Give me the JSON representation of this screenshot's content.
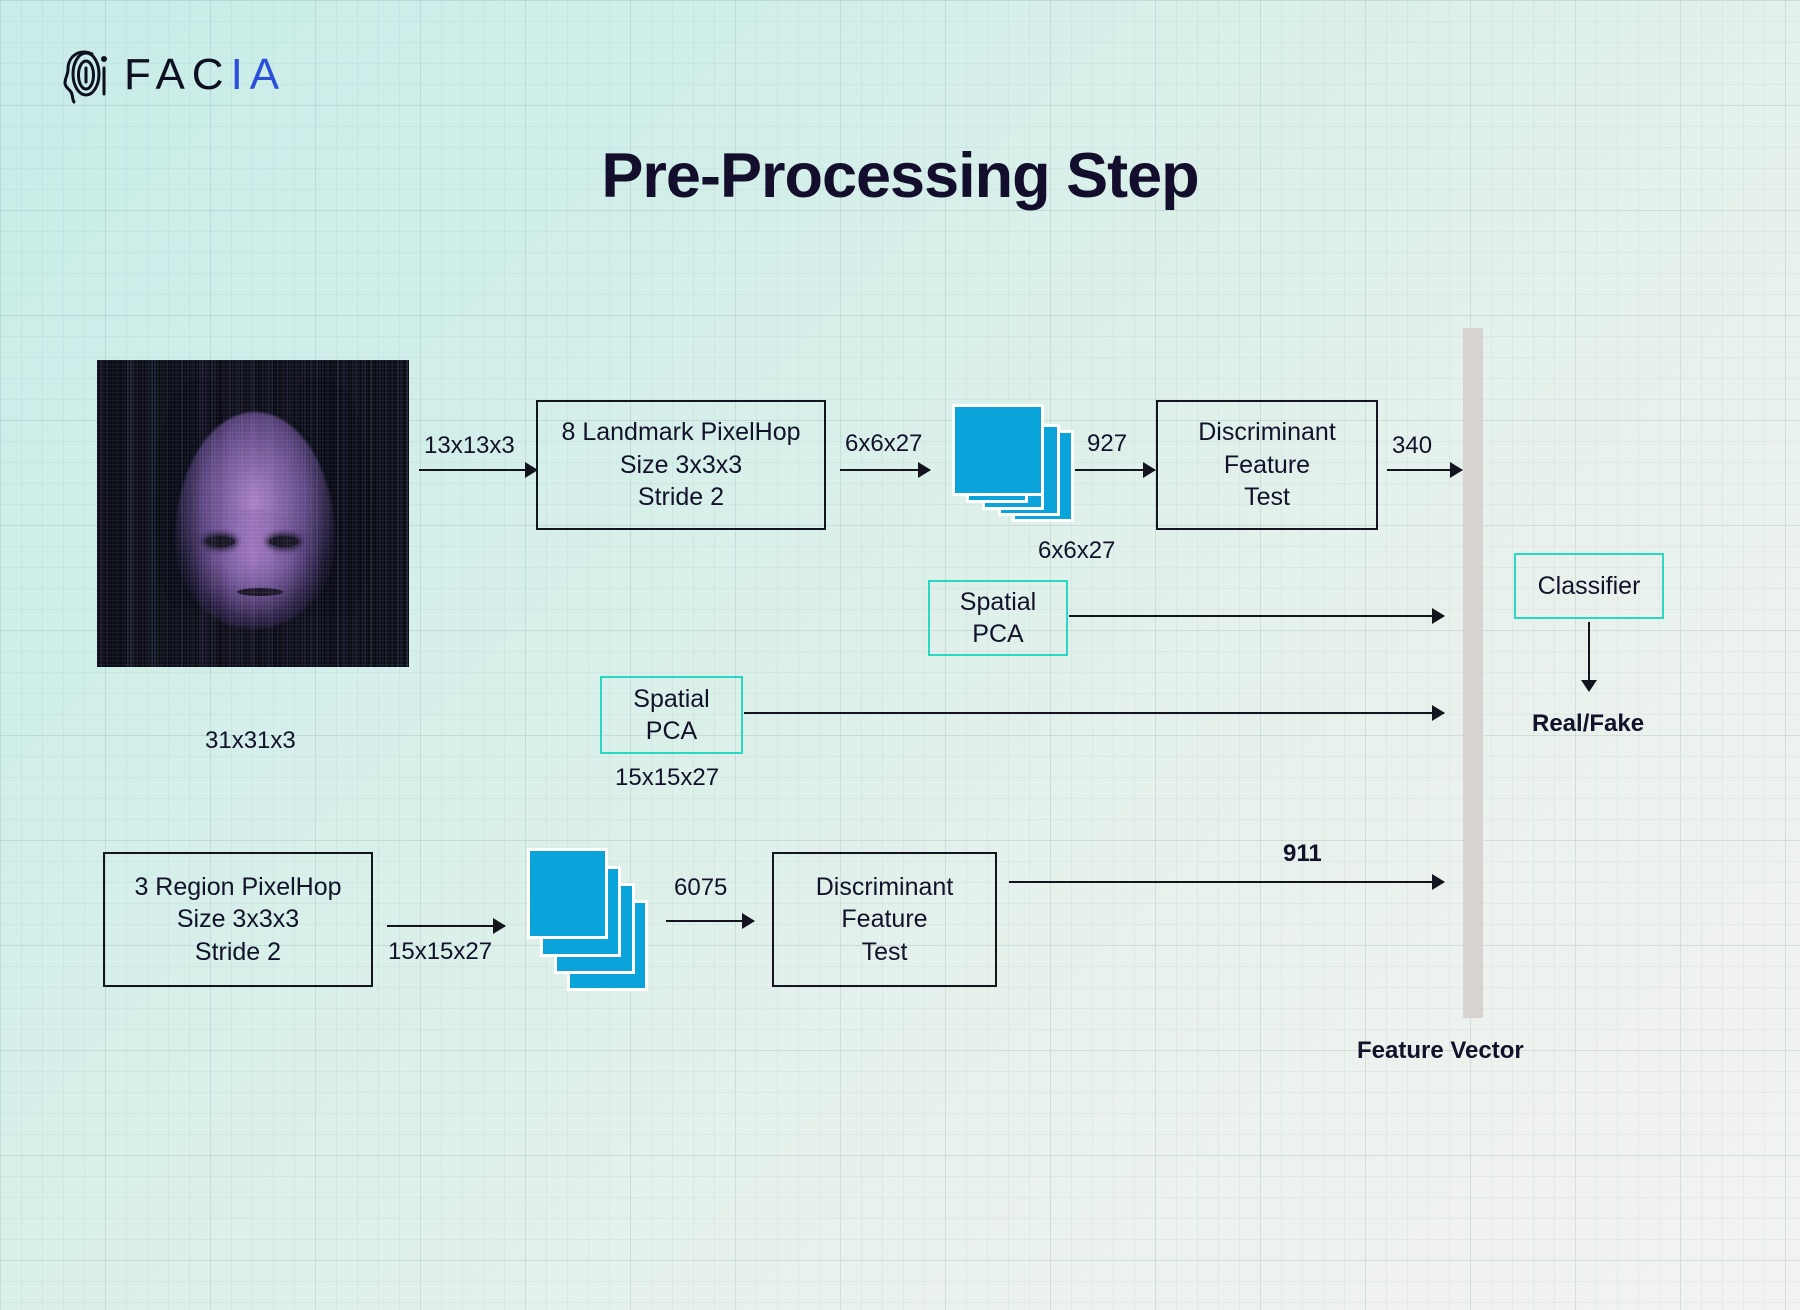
{
  "brand": {
    "name_dark": "FAC",
    "name_accent": "IA",
    "logo_icon": "fingerprint-icon"
  },
  "title": "Pre-Processing Step",
  "input": {
    "image_alt": "face-scan-image",
    "dimension_label": "31x31x3"
  },
  "flow": {
    "arrow_13x13x3": "13x13x3",
    "landmark_box": {
      "line1": "8 Landmark PixelHop",
      "line2": "Size 3x3x3",
      "line3": "Stride 2"
    },
    "arrow_6x6x27": "6x6x27",
    "cube_label_6x6x27": "6x6x27",
    "arrow_927": "927",
    "dft_top": {
      "line1": "Discriminant",
      "line2": "Feature",
      "line3": "Test"
    },
    "arrow_340": "340",
    "spatial_pca_top": {
      "line1": "Spatial",
      "line2": "PCA"
    },
    "spatial_pca_mid": {
      "line1": "Spatial",
      "line2": "PCA"
    },
    "label_15x15x27_mid": "15x15x27",
    "region_box": {
      "line1": "3 Region PixelHop",
      "line2": "Size 3x3x3",
      "line3": "Stride 2"
    },
    "arrow_15x15x27": "15x15x27",
    "arrow_6075": "6075",
    "dft_bottom": {
      "line1": "Discriminant",
      "line2": "Feature",
      "line3": "Test"
    },
    "arrow_911": "911"
  },
  "output": {
    "feature_vector_label": "Feature Vector",
    "classifier_label": "Classifier",
    "result_label": "Real/Fake"
  },
  "colors": {
    "accent_blue": "#0aa3da",
    "teal_border": "#2ad6c4",
    "ink": "#12122a",
    "logo_blue": "#2b4fd8",
    "feature_bar": "#d6d3d1"
  }
}
